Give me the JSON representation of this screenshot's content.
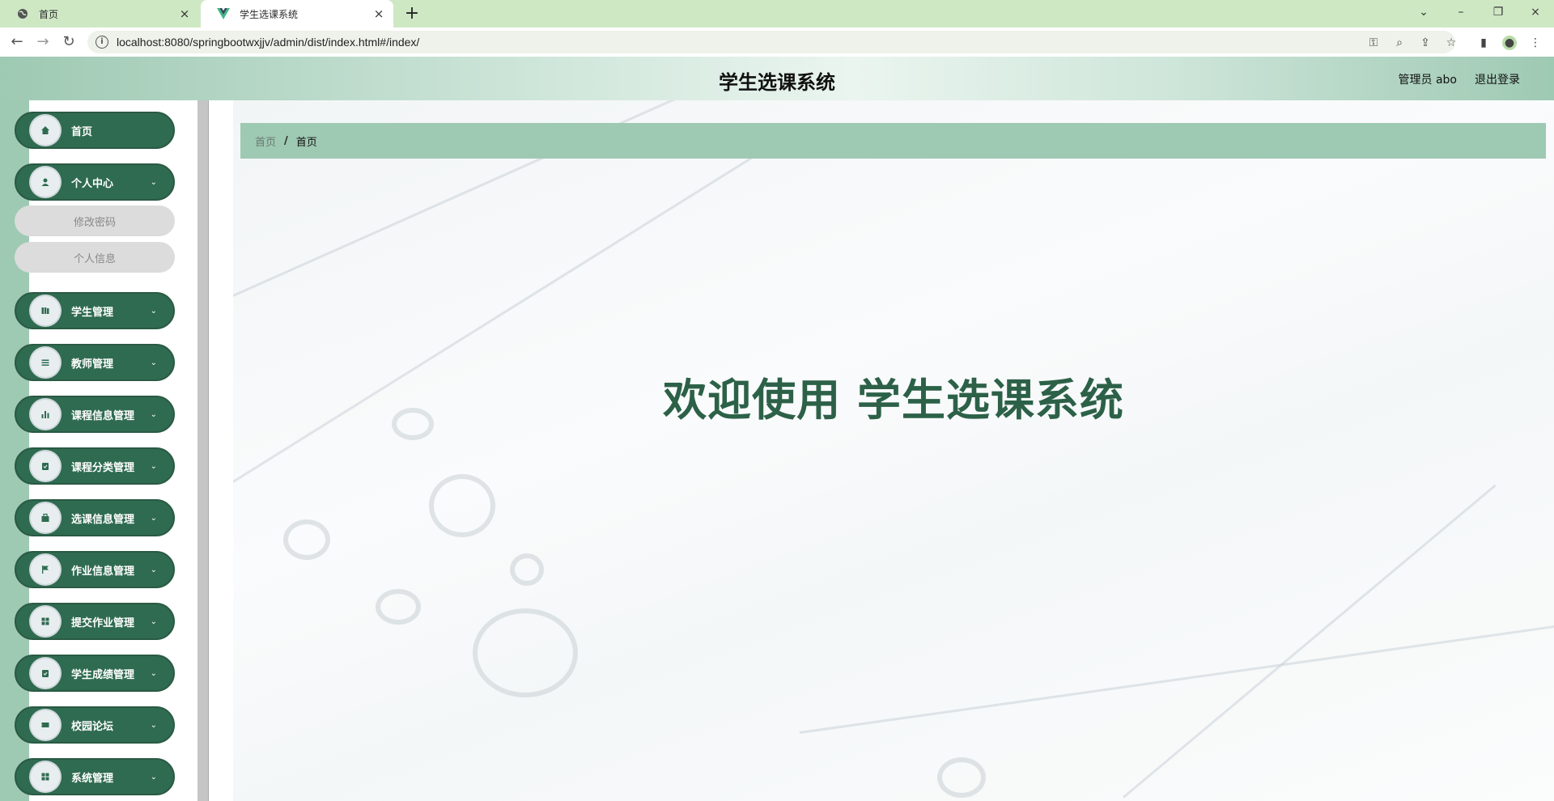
{
  "browser": {
    "tabs": [
      {
        "title": "首页",
        "close": "×"
      },
      {
        "title": "学生选课系统",
        "close": "×"
      }
    ],
    "new_tab": "+",
    "url": "localhost:8080/springbootwxjjv/admin/dist/index.html#/index/",
    "window_controls": {
      "minimize": "–",
      "restore": "❐",
      "close": "×",
      "tab_search": "⌄"
    }
  },
  "header": {
    "title": "学生选课系统",
    "user": "管理员 abo",
    "logout": "退出登录"
  },
  "sidebar": {
    "items": [
      {
        "label": "首页",
        "icon": "home-icon",
        "has_arrow": false
      },
      {
        "label": "个人中心",
        "icon": "user-icon",
        "has_arrow": true,
        "children": [
          "修改密码",
          "个人信息"
        ]
      },
      {
        "label": "学生管理",
        "icon": "book-icon",
        "has_arrow": true
      },
      {
        "label": "教师管理",
        "icon": "list-icon",
        "has_arrow": true
      },
      {
        "label": "课程信息管理",
        "icon": "chart-icon",
        "has_arrow": true
      },
      {
        "label": "课程分类管理",
        "icon": "clipboard-icon",
        "has_arrow": true
      },
      {
        "label": "选课信息管理",
        "icon": "briefcase-icon",
        "has_arrow": true
      },
      {
        "label": "作业信息管理",
        "icon": "flag-icon",
        "has_arrow": true
      },
      {
        "label": "提交作业管理",
        "icon": "grid-icon",
        "has_arrow": true
      },
      {
        "label": "学生成绩管理",
        "icon": "calendar-check-icon",
        "has_arrow": true
      },
      {
        "label": "校园论坛",
        "icon": "video-icon",
        "has_arrow": true
      },
      {
        "label": "系统管理",
        "icon": "grid-icon",
        "has_arrow": true
      }
    ]
  },
  "breadcrumb": {
    "home": "首页",
    "separator": "/",
    "current": "首页"
  },
  "welcome": "欢迎使用 学生选课系统",
  "colors": {
    "primary": "#2f6b50",
    "accent_light": "#9ec9b3",
    "tabbar": "#cfe8c4"
  }
}
